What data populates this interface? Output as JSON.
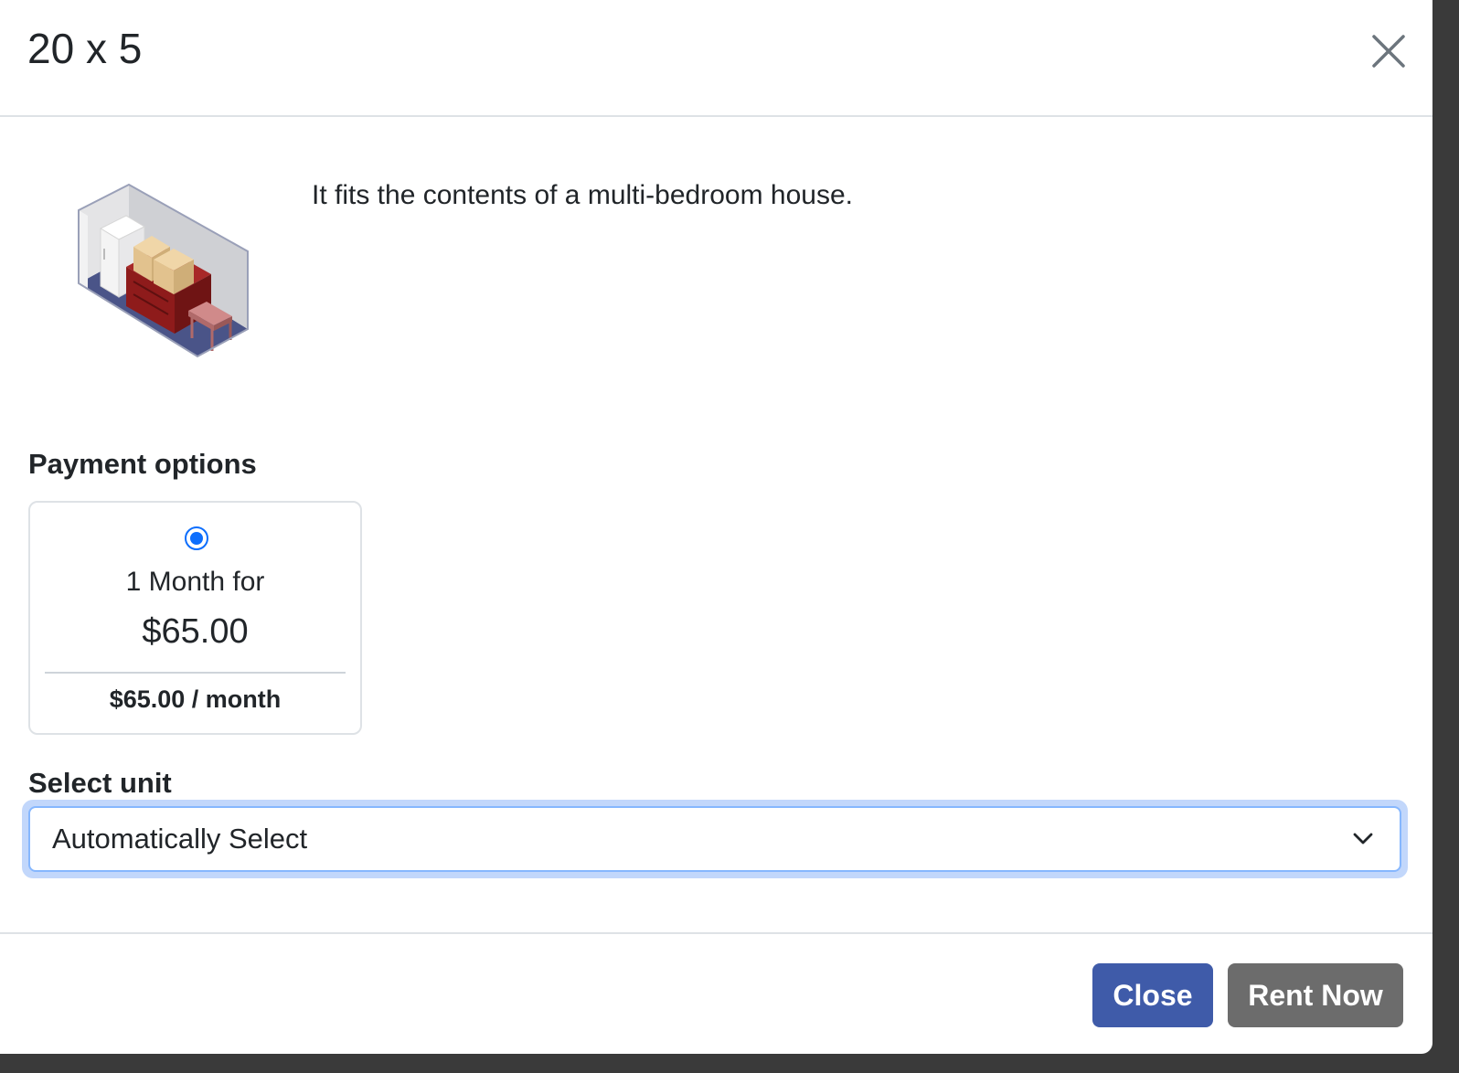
{
  "modal": {
    "title": "20 x 5",
    "close_icon": "close-icon"
  },
  "unit": {
    "description": "It fits the contents of a multi-bedroom house.",
    "image": "storage-unit-illustration"
  },
  "payment": {
    "label": "Payment options",
    "options": [
      {
        "selected": true,
        "term": "1 Month for",
        "price": "$65.00",
        "monthly": "$65.00 / month"
      }
    ]
  },
  "unit_select": {
    "label": "Select unit",
    "value": "Automatically Select",
    "icon": "chevron-down-icon"
  },
  "footer": {
    "close_label": "Close",
    "rent_label": "Rent Now"
  },
  "colors": {
    "primary_button": "#3f5ba9",
    "secondary_button": "#6c6c6c",
    "radio_accent": "#0d6efd",
    "focus_ring": "#86b7fe"
  }
}
